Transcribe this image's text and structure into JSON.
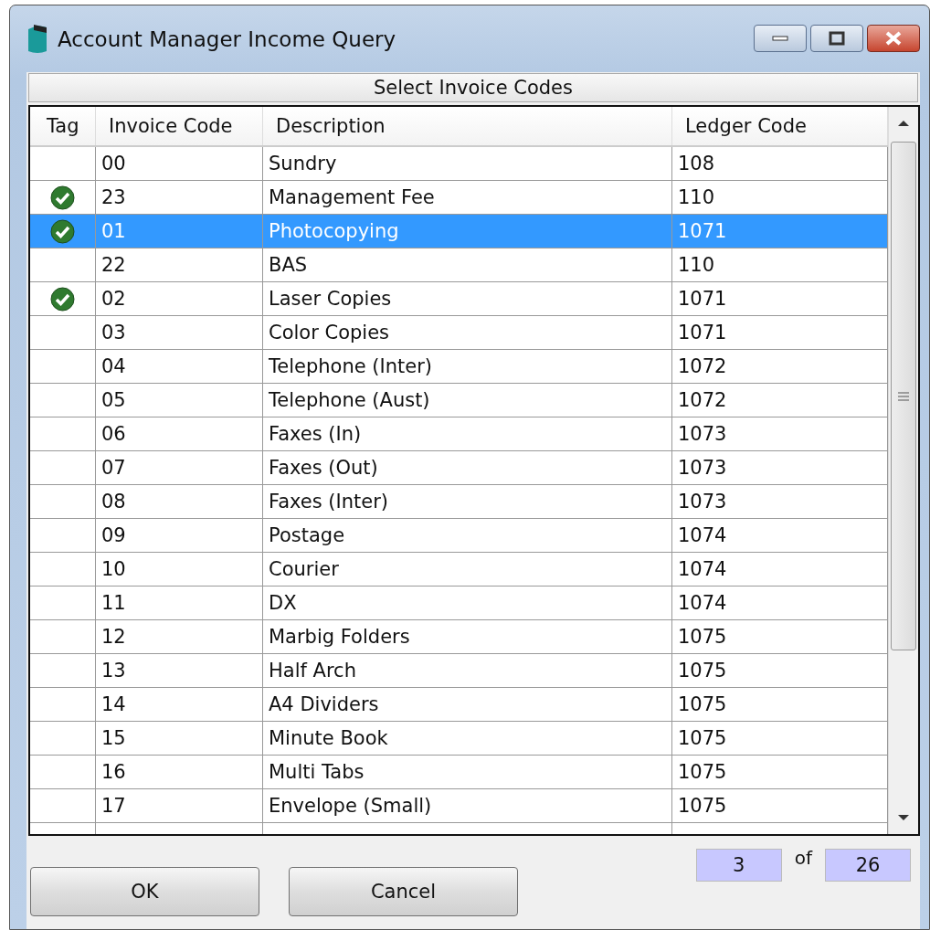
{
  "window": {
    "title": "Account Manager Income Query"
  },
  "caption": "Select Invoice Codes",
  "table": {
    "columns": [
      "Tag",
      "Invoice Code",
      "Description",
      "Ledger Code"
    ],
    "rows": [
      {
        "tagged": false,
        "selected": false,
        "code": "00",
        "description": "Sundry",
        "ledger": "108"
      },
      {
        "tagged": true,
        "selected": false,
        "code": "23",
        "description": "Management Fee",
        "ledger": "110"
      },
      {
        "tagged": true,
        "selected": true,
        "code": "01",
        "description": "Photocopying",
        "ledger": "1071"
      },
      {
        "tagged": false,
        "selected": false,
        "code": "22",
        "description": "BAS",
        "ledger": "110"
      },
      {
        "tagged": true,
        "selected": false,
        "code": "02",
        "description": "Laser Copies",
        "ledger": "1071"
      },
      {
        "tagged": false,
        "selected": false,
        "code": "03",
        "description": "Color Copies",
        "ledger": "1071"
      },
      {
        "tagged": false,
        "selected": false,
        "code": "04",
        "description": "Telephone (Inter)",
        "ledger": "1072"
      },
      {
        "tagged": false,
        "selected": false,
        "code": "05",
        "description": "Telephone (Aust)",
        "ledger": "1072"
      },
      {
        "tagged": false,
        "selected": false,
        "code": "06",
        "description": "Faxes (In)",
        "ledger": "1073"
      },
      {
        "tagged": false,
        "selected": false,
        "code": "07",
        "description": "Faxes (Out)",
        "ledger": "1073"
      },
      {
        "tagged": false,
        "selected": false,
        "code": "08",
        "description": "Faxes (Inter)",
        "ledger": "1073"
      },
      {
        "tagged": false,
        "selected": false,
        "code": "09",
        "description": "Postage",
        "ledger": "1074"
      },
      {
        "tagged": false,
        "selected": false,
        "code": "10",
        "description": "Courier",
        "ledger": "1074"
      },
      {
        "tagged": false,
        "selected": false,
        "code": "11",
        "description": "DX",
        "ledger": "1074"
      },
      {
        "tagged": false,
        "selected": false,
        "code": "12",
        "description": "Marbig Folders",
        "ledger": "1075"
      },
      {
        "tagged": false,
        "selected": false,
        "code": "13",
        "description": "Half Arch",
        "ledger": "1075"
      },
      {
        "tagged": false,
        "selected": false,
        "code": "14",
        "description": "A4 Dividers",
        "ledger": "1075"
      },
      {
        "tagged": false,
        "selected": false,
        "code": "15",
        "description": "Minute Book",
        "ledger": "1075"
      },
      {
        "tagged": false,
        "selected": false,
        "code": "16",
        "description": "Multi Tabs",
        "ledger": "1075"
      },
      {
        "tagged": false,
        "selected": false,
        "code": "17",
        "description": "Envelope (Small)",
        "ledger": "1075"
      }
    ]
  },
  "counter": {
    "current": "3",
    "separator": "of",
    "total": "26"
  },
  "buttons": [
    "OK",
    "Cancel"
  ]
}
